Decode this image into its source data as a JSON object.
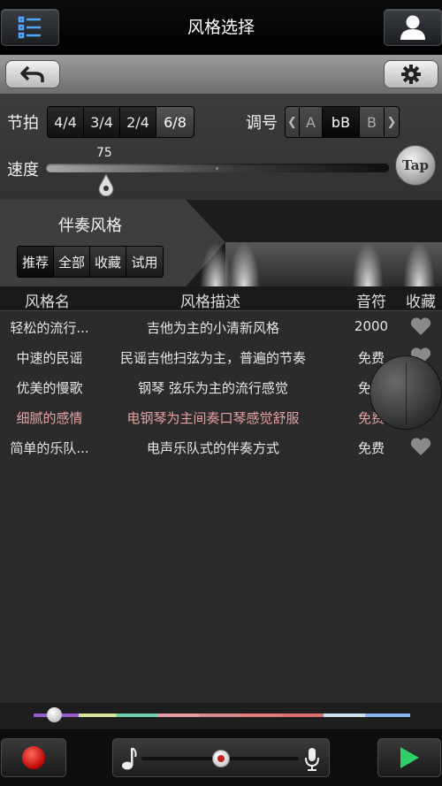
{
  "header": {
    "title": "风格选择"
  },
  "settings": {
    "beat_label": "节拍",
    "beat_options": [
      "4/4",
      "3/4",
      "2/4",
      "6/8"
    ],
    "beat_selected": "6/8",
    "key_label": "调号",
    "key_prev_glyph": "❮",
    "key_next_glyph": "❯",
    "key_options": [
      "A",
      "bB",
      "B"
    ],
    "key_selected": "bB",
    "speed_label": "速度",
    "speed_value": "75",
    "tap_label": "Tap"
  },
  "style_panel": {
    "title": "伴奏风格",
    "tabs": [
      "推荐",
      "全部",
      "收藏",
      "试用"
    ]
  },
  "table": {
    "headers": {
      "name": "风格名",
      "desc": "风格描述",
      "price": "音符",
      "fav": "收藏"
    },
    "rows": [
      {
        "name": "轻松的流行...",
        "desc": "吉他为主的小清新风格",
        "price": "2000"
      },
      {
        "name": "中速的民谣",
        "desc": "民谣吉他扫弦为主，普遍的节奏",
        "price": "免费"
      },
      {
        "name": "优美的慢歌",
        "desc": "钢琴 弦乐为主的流行感觉",
        "price": "免费"
      },
      {
        "name": "细腻的感情",
        "desc": "电钢琴为主间奏口琴感觉舒服",
        "price": "免费"
      },
      {
        "name": "简单的乐队...",
        "desc": "电声乐队式的伴奏方式",
        "price": "免费"
      }
    ],
    "highlight_color": "#e8a0a0"
  },
  "icons": {
    "menu": "list-menu-icon",
    "user": "user-icon",
    "back": "back-arrow-icon",
    "settings": "gear-icon",
    "favorite": "heart-icon",
    "record": "record-icon",
    "music_note": "music-note-icon",
    "microphone": "microphone-icon",
    "play": "play-icon"
  },
  "colors": {
    "record": "#e01010",
    "play": "#2ed06a",
    "progress_segments": [
      "#9a5cc8",
      "#d9e79a",
      "#6fd0b0",
      "#e59aa0",
      "#d88a8a",
      "#e07b7b",
      "#dc6f6f",
      "#cfe0f0",
      "#89b6f0"
    ]
  }
}
